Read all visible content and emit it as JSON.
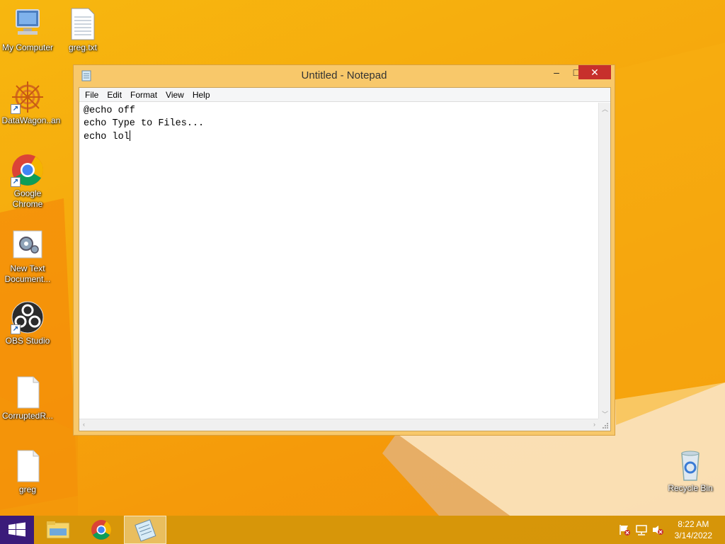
{
  "desktop": {
    "icons": [
      {
        "label": "My Computer"
      },
      {
        "label": "greg.txt"
      },
      {
        "label": "DataWagon..."
      },
      {
        "label": "an"
      },
      {
        "label": "Google Chrome"
      },
      {
        "label": "New Text Document..."
      },
      {
        "label": "OBS Studio"
      },
      {
        "label": "CorruptedR..."
      },
      {
        "label": "greg"
      },
      {
        "label": "Recycle Bin"
      }
    ]
  },
  "notepad": {
    "title": "Untitled - Notepad",
    "menu": [
      "File",
      "Edit",
      "Format",
      "View",
      "Help"
    ],
    "lines": [
      "@echo off",
      "echo Type to Files...",
      "echo lol"
    ],
    "buttons": {
      "minimize": "–",
      "maximize": "□",
      "close": "✕"
    }
  },
  "taskbar": {
    "apps": [
      "start",
      "file-explorer",
      "google-chrome",
      "notepad"
    ],
    "active": "notepad"
  },
  "clock": {
    "time": "8:22 AM",
    "date": "3/14/2022"
  },
  "colors": {
    "accent": "#f6a80d",
    "close": "#c7302c",
    "start": "#3a1b7a"
  }
}
